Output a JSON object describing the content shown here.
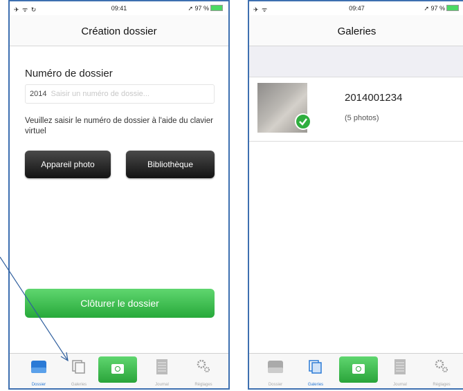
{
  "left_screen": {
    "status": {
      "left": "✈ ᯤ ↻",
      "time": "09:41",
      "right": "➚ 97 %"
    },
    "nav_title": "Création dossier",
    "field_label": "Numéro de dossier",
    "input": {
      "prefix": "2014",
      "placeholder": "Saisir un numéro de dossie..."
    },
    "help_text": "Veuillez saisir le numéro de dossier à l'aide du clavier virtuel",
    "buttons": {
      "camera": "Appareil photo",
      "library": "Bibliothèque",
      "close": "Clôturer le dossier"
    },
    "tabs": [
      "Dossier",
      "Galeries",
      "",
      "Journal",
      "Réglages"
    ]
  },
  "right_screen": {
    "status": {
      "left": "✈ ᯤ",
      "time": "09:47",
      "right": "➚ 97 %"
    },
    "nav_title": "Galeries",
    "gallery": {
      "title": "2014001234",
      "count": "(5 photos)"
    },
    "tabs": [
      "Dossier",
      "Galeries",
      "",
      "Journal",
      "Réglages"
    ]
  },
  "colors": {
    "frame": "#3d6fb0",
    "accent_green": "#2faa40",
    "active_tab": "#2a7ad6"
  },
  "icons": [
    "folder-icon",
    "gallery-icon",
    "camera-icon",
    "journal-icon",
    "gear-icon",
    "checkmark-icon"
  ]
}
